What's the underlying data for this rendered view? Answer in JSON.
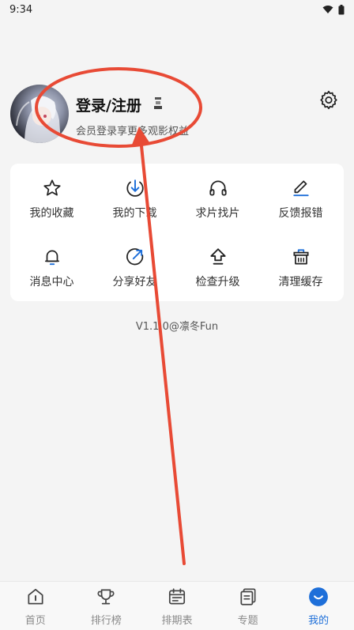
{
  "status_bar": {
    "time": "9:34"
  },
  "profile": {
    "title": "登录/注册",
    "subtitle": "会员登录享更多观影权益"
  },
  "grid": [
    {
      "label": "我的收藏",
      "icon": "star-icon"
    },
    {
      "label": "我的下载",
      "icon": "download-icon"
    },
    {
      "label": "求片找片",
      "icon": "headphones-icon"
    },
    {
      "label": "反馈报错",
      "icon": "edit-icon"
    },
    {
      "label": "消息中心",
      "icon": "bell-icon"
    },
    {
      "label": "分享好友",
      "icon": "share-icon"
    },
    {
      "label": "检查升级",
      "icon": "upgrade-icon"
    },
    {
      "label": "清理缓存",
      "icon": "basket-icon"
    }
  ],
  "version": "V1.1.0@凛冬Fun",
  "tabbar": {
    "items": [
      {
        "label": "首页",
        "icon": "home-icon"
      },
      {
        "label": "排行榜",
        "icon": "trophy-icon"
      },
      {
        "label": "排期表",
        "icon": "calendar-icon"
      },
      {
        "label": "专题",
        "icon": "topics-icon"
      },
      {
        "label": "我的",
        "icon": "profile-icon"
      }
    ],
    "active_index": 4
  },
  "colors": {
    "accent": "#1e6fd9",
    "annotation": "#e84a35"
  }
}
